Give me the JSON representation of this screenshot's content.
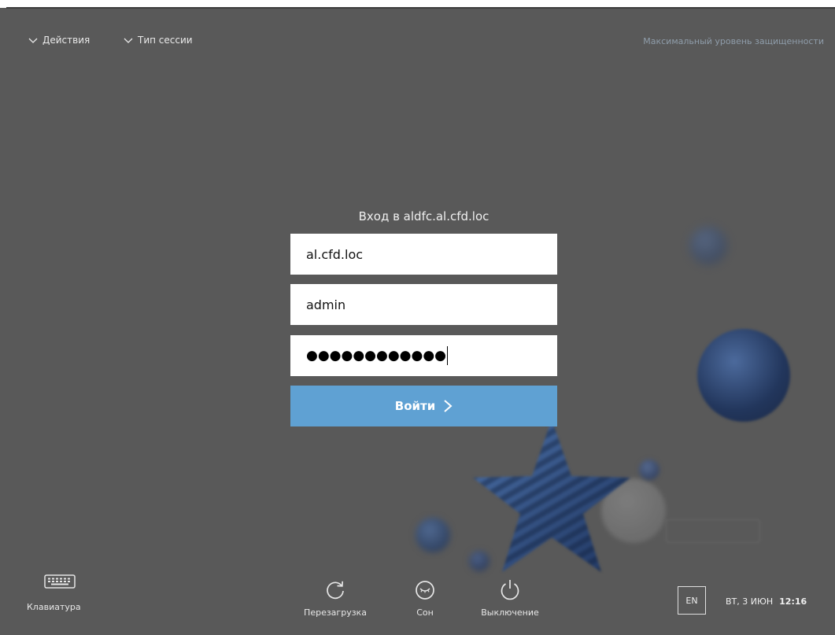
{
  "top_menu": {
    "actions_label": "Действия",
    "session_type_label": "Тип сессии",
    "security_level": "Максимальный уровень защищенности"
  },
  "login": {
    "title": "Вход в aldfc.al.cfd.loc",
    "domain_value": "al.cfd.loc",
    "username_value": "admin",
    "password_mask": "●●●●●●●●●●●●",
    "submit_label": "Войти"
  },
  "bottom_bar": {
    "keyboard_label": "Клавиатура",
    "reboot_label": "Перезагрузка",
    "sleep_label": "Сон",
    "shutdown_label": "Выключение",
    "language": "EN",
    "date": "ВТ, 3 ИЮН",
    "time": "12:16"
  },
  "colors": {
    "background": "#595959",
    "login_button": "#5fa1d3",
    "security_text": "#8f9daa"
  }
}
